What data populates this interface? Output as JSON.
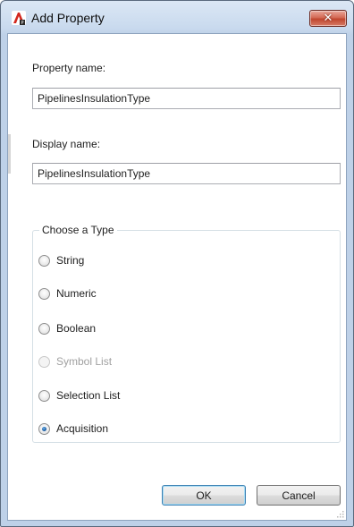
{
  "window": {
    "title": "Add Property",
    "close_icon": "close-icon",
    "app_icon": "autocad-icon"
  },
  "property_name": {
    "label": "Property name:",
    "value": "PipelinesInsulationType"
  },
  "display_name": {
    "label": "Display name:",
    "value": "PipelinesInsulationType"
  },
  "type_group": {
    "title": "Choose a Type",
    "options": [
      {
        "label": "String",
        "checked": false,
        "enabled": true
      },
      {
        "label": "Numeric",
        "checked": false,
        "enabled": true
      },
      {
        "label": "Boolean",
        "checked": false,
        "enabled": true
      },
      {
        "label": "Symbol List",
        "checked": false,
        "enabled": false
      },
      {
        "label": "Selection List",
        "checked": false,
        "enabled": true
      },
      {
        "label": "Acquisition",
        "checked": true,
        "enabled": true
      }
    ]
  },
  "buttons": {
    "ok_label": "OK",
    "cancel_label": "Cancel"
  },
  "colors": {
    "close_button": "#c0462f",
    "selected_radio": "#1d5fa6",
    "default_button_border": "#3c7fb1"
  }
}
